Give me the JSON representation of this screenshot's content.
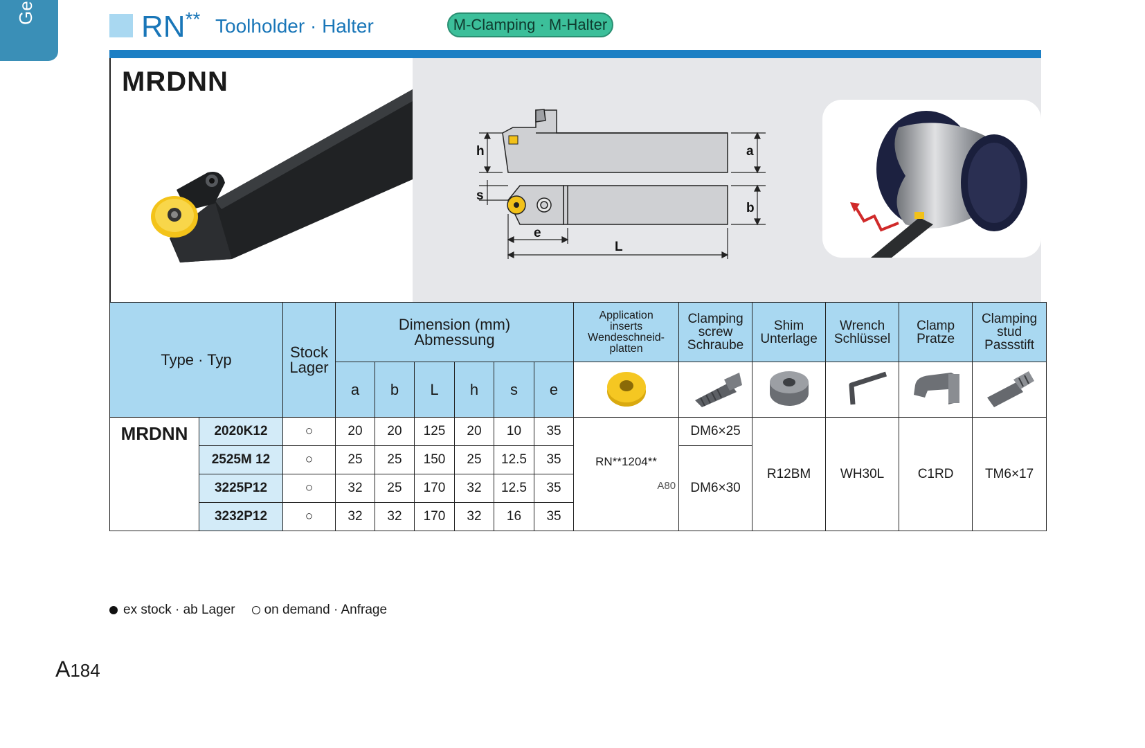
{
  "side_tab": "Ge",
  "header": {
    "title_main": "RN",
    "title_sup": "**",
    "title_sub": "Toolholder · Halter",
    "clamping": "M-Clamping · M-Halter"
  },
  "figure": {
    "title": "MRDNN",
    "dims": {
      "h": "h",
      "a": "a",
      "s": "s",
      "b": "b",
      "e": "e",
      "L": "L"
    }
  },
  "table": {
    "headers": {
      "type": "Type · Typ",
      "stock": [
        "Stock",
        "Lager"
      ],
      "dimension": [
        "Dimension (mm)",
        "Abmessung"
      ],
      "dim_cols": [
        "a",
        "b",
        "L",
        "h",
        "s",
        "e"
      ],
      "application": [
        "Application",
        "inserts",
        "Wendeschneid-",
        "platten"
      ],
      "clamping_screw": [
        "Clamping",
        "screw",
        "Schraube"
      ],
      "shim": [
        "Shim",
        "Unterlage"
      ],
      "wrench": [
        "Wrench",
        "Schlüssel"
      ],
      "clamp": [
        "Clamp",
        "Pratze"
      ],
      "clamping_stud": [
        "Clamping",
        "stud",
        "Passstift"
      ]
    },
    "type_name": "MRDNN",
    "rows": [
      {
        "code": "2020K12",
        "stock": "○",
        "a": "20",
        "b": "20",
        "L": "125",
        "h": "20",
        "s": "10",
        "e": "35"
      },
      {
        "code": "2525M 12",
        "stock": "○",
        "a": "25",
        "b": "25",
        "L": "150",
        "h": "25",
        "s": "12.5",
        "e": "35"
      },
      {
        "code": "3225P12",
        "stock": "○",
        "a": "32",
        "b": "25",
        "L": "170",
        "h": "32",
        "s": "12.5",
        "e": "35"
      },
      {
        "code": "3232P12",
        "stock": "○",
        "a": "32",
        "b": "32",
        "L": "170",
        "h": "32",
        "s": "16",
        "e": "35"
      }
    ],
    "insert": "RN**1204**",
    "insert_page": "A80",
    "screw_1": "DM6×25",
    "screw_2": "DM6×30",
    "shim": "R12BM",
    "wrench": "WH30L",
    "clamp": "C1RD",
    "stud": "TM6×17"
  },
  "legend": {
    "ex_stock": "ex stock · ab Lager",
    "on_demand": "on demand · Anfrage"
  },
  "page": {
    "letter": "A",
    "number": "184"
  }
}
